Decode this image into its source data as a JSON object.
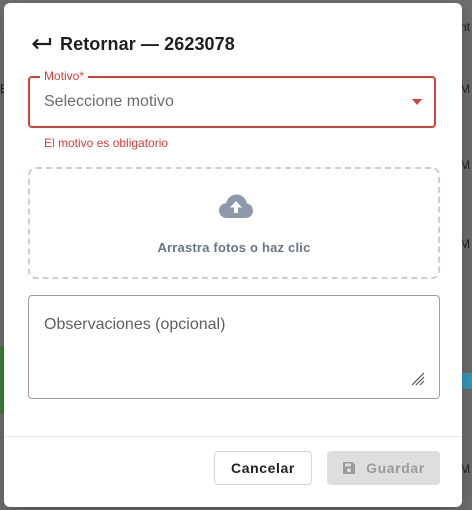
{
  "background": {
    "cells": [
      "nt",
      "E",
      "M",
      "M",
      "M",
      "M",
      "M"
    ]
  },
  "dialog": {
    "title": "Retornar — 2623078",
    "motivo": {
      "label": "Motivo*",
      "placeholder": "Seleccione motivo",
      "error": "El motivo es obligatorio"
    },
    "dropzone": {
      "text": "Arrastra fotos o haz clic"
    },
    "observaciones": {
      "placeholder": "Observaciones (opcional)"
    },
    "buttons": {
      "cancel": "Cancelar",
      "save": "Guardar"
    }
  },
  "colors": {
    "error": "#d3413a",
    "disabled_bg": "#dedede",
    "disabled_text": "#9a9a9a",
    "dropzone_border": "#c8d0dc"
  },
  "icons": [
    "back-arrow-icon",
    "chevron-down-icon",
    "cloud-upload-icon",
    "resize-handle-icon",
    "save-icon"
  ]
}
